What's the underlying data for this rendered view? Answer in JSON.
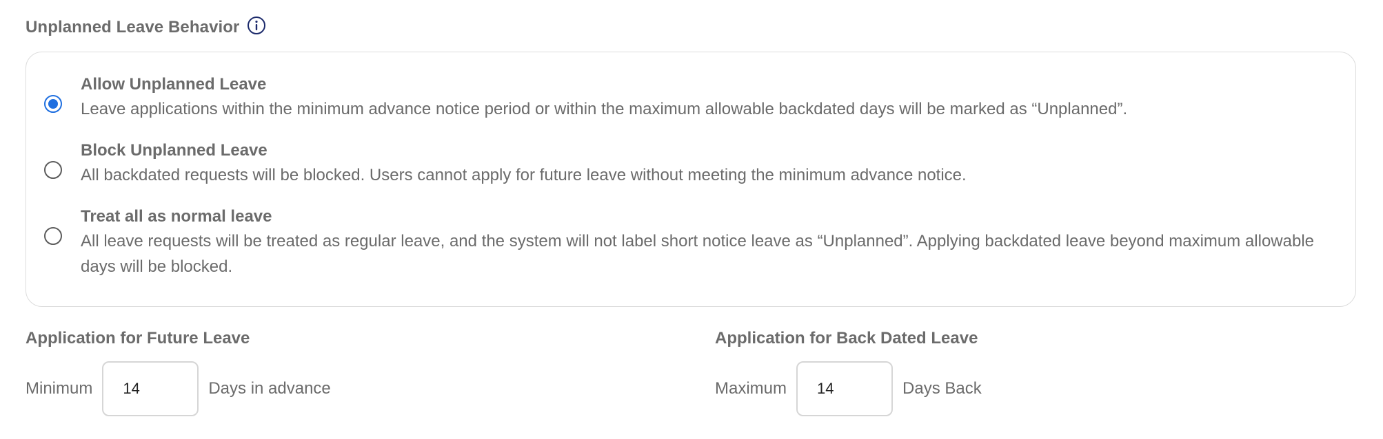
{
  "section": {
    "title": "Unplanned Leave Behavior",
    "info_icon": "info-icon"
  },
  "options": [
    {
      "title": "Allow Unplanned Leave",
      "description": "Leave applications within the minimum advance notice period or within the maximum allowable backdated days will be marked as “Unplanned”.",
      "selected": true
    },
    {
      "title": "Block Unplanned Leave",
      "description": "All backdated requests will be blocked. Users cannot apply for future leave without meeting the minimum advance notice.",
      "selected": false
    },
    {
      "title": "Treat all as normal leave",
      "description": "All leave requests will be treated as regular leave, and the system will not label short notice leave as “Unplanned”. Applying backdated leave beyond maximum allowable days will be blocked.",
      "selected": false
    }
  ],
  "future_leave": {
    "label": "Application for Future Leave",
    "prefix": "Minimum",
    "value": "14",
    "suffix": "Days in advance"
  },
  "back_dated_leave": {
    "label": "Application for Back Dated Leave",
    "prefix": "Maximum",
    "value": "14",
    "suffix": "Days Back"
  },
  "colors": {
    "accent": "#1f6fe0",
    "text": "#6b6b6b",
    "border": "#dcdcdc",
    "info_icon": "#1c2a6b"
  }
}
